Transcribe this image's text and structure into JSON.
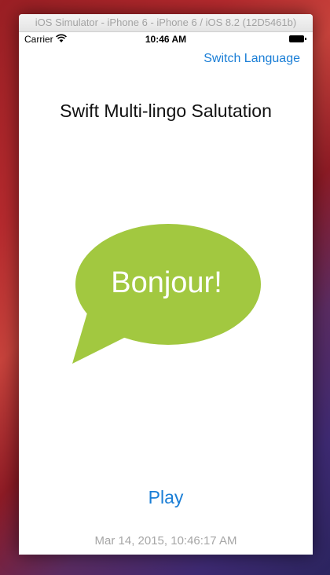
{
  "window": {
    "title": "iOS Simulator - iPhone 6 - iPhone 6 / iOS 8.2 (12D5461b)"
  },
  "status_bar": {
    "carrier": "Carrier",
    "time": "10:46 AM",
    "wifi_icon": "wifi-icon",
    "battery_icon": "battery-icon",
    "battery_level": 1.0
  },
  "nav": {
    "switch_language_label": "Switch Language"
  },
  "main": {
    "title": "Swift Multi-lingo Salutation",
    "greeting": "Bonjour!",
    "bubble_color": "#a2c840",
    "play_label": "Play",
    "timestamp": "Mar 14, 2015, 10:46:17 AM"
  },
  "colors": {
    "accent": "#1a7ed6",
    "timestamp_gray": "#a6a6a6"
  }
}
